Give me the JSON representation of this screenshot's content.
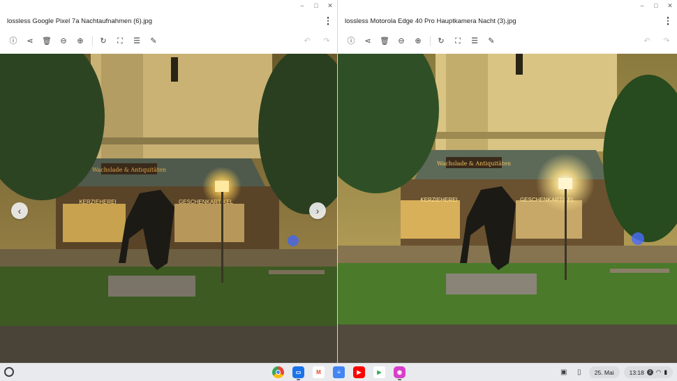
{
  "left_window": {
    "title": "lossless Google Pixel 7a Nachtaufnahmen (6).jpg",
    "caption": {
      "minimize": "–",
      "maximize": "□",
      "close": "✕"
    },
    "image_alt": "Night photo of equestrian statue in front of church and shop",
    "nav_prev": "‹",
    "nav_next": "›",
    "shop_sign_left": "Wachslade & Antiquitäten",
    "shop_sign_text1": "KERZIEHEREI",
    "shop_sign_text2": "GESCHENKARTIKEL"
  },
  "right_window": {
    "title": "lossless Motorola Edge 40 Pro Hauptkamera Nacht (3).jpg",
    "caption": {
      "minimize": "–",
      "maximize": "□",
      "close": "✕"
    },
    "image_alt": "Night photo of equestrian statue in front of church and shop",
    "shop_sign_left": "Wachslade & Antiquitäten",
    "shop_sign_text1": "KERZIEHEREI",
    "shop_sign_text2": "GESCHENKARTIKEL"
  },
  "toolbar": {
    "icons": [
      "info-icon",
      "share-icon",
      "delete-icon",
      "zoom-out-icon",
      "zoom-in-icon",
      "rotate-icon",
      "crop-icon",
      "adjust-icon",
      "lighting-icon"
    ],
    "glyphs": {
      "info": "ⓘ",
      "share": "⋖",
      "delete": "🗑",
      "zoom_out": "⊖",
      "zoom_in": "⊕",
      "rotate": "↻",
      "crop": "⛶",
      "adjust": "☰",
      "lighting": "✎",
      "undo": "↶",
      "redo": "↷"
    }
  },
  "shelf": {
    "apps": [
      {
        "name": "Chrome",
        "color": "#ea4335"
      },
      {
        "name": "Files",
        "color": "#1a73e8"
      },
      {
        "name": "Gmail",
        "color": "#ffffff"
      },
      {
        "name": "Docs",
        "color": "#4285f4"
      },
      {
        "name": "YouTube",
        "color": "#ff0000"
      },
      {
        "name": "Play Store",
        "color": "#ffffff"
      },
      {
        "name": "Gallery",
        "color": "#d93fc8"
      }
    ],
    "date": "25. Mai",
    "time": "13:18",
    "notification_count": "2"
  }
}
